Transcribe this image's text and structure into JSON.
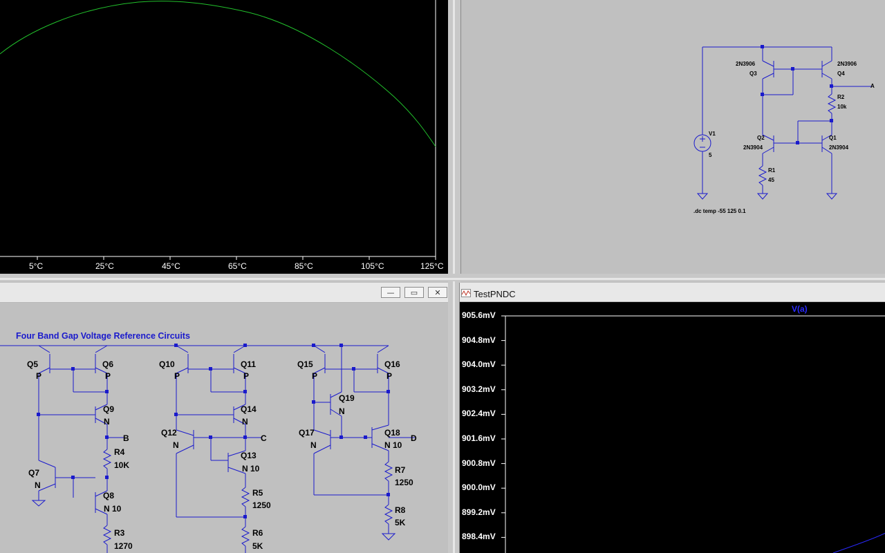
{
  "top_left_plot": {
    "x_ticks": [
      "5°C",
      "25°C",
      "45°C",
      "65°C",
      "85°C",
      "105°C",
      "125°C"
    ],
    "trace_color": "#22c22c"
  },
  "schematic_top": {
    "labels": {
      "q3_model": "2N3906",
      "q3": "Q3",
      "q4_model": "2N3906",
      "q4": "Q4",
      "r2": "R2",
      "r2_val": "10k",
      "node_a": "A",
      "v1": "V1",
      "v1_val": "5",
      "q2": "Q2",
      "q2_model": "2N3904",
      "q1": "Q1",
      "q1_model": "2N3904",
      "r1": "R1",
      "r1_val": "45",
      "directive": ".dc temp -55 125 0.1"
    }
  },
  "schematic_window": {
    "buttons": {
      "minimize": "—",
      "restore": "▭",
      "close": "✕"
    },
    "heading": "Four Band Gap Voltage Reference Circuits",
    "labels": {
      "q5": "Q5",
      "q5_type": "P",
      "q6": "Q6",
      "q6_type": "P",
      "q9": "Q9",
      "q9_type": "N",
      "r4": "R4",
      "r4_val": "10K",
      "node_b": "B",
      "q7": "Q7",
      "q7_type": "N",
      "q8": "Q8",
      "q8_type": "N  10",
      "r3": "R3",
      "r3_val": "1270",
      "q10": "Q10",
      "q10_type": "P",
      "q11": "Q11",
      "q11_type": "P",
      "q14": "Q14",
      "q14_type": "N",
      "q12": "Q12",
      "q12_type": "N",
      "node_c": "C",
      "q13": "Q13",
      "q13_type": "N  10",
      "r5": "R5",
      "r5_val": "1250",
      "r6": "R6",
      "r6_val": "5K",
      "q15": "Q15",
      "q15_type": "P",
      "q16": "Q16",
      "q16_type": "P",
      "q19": "Q19",
      "q19_type": "N",
      "q17": "Q17",
      "q17_type": "N",
      "q18": "Q18",
      "q18_type": "N  10",
      "node_d": "D",
      "r7": "R7",
      "r7_val": "1250",
      "r8": "R8",
      "r8_val": "5K"
    }
  },
  "plot_window": {
    "title": "TestPNDC",
    "buttons": {
      "minimize": "—",
      "restore": "▭",
      "close": "✕"
    },
    "trace_label": "V(a)",
    "y_ticks": [
      "905.6mV",
      "904.8mV",
      "904.0mV",
      "903.2mV",
      "902.4mV",
      "901.6mV",
      "900.8mV",
      "900.0mV",
      "899.2mV",
      "898.4mV"
    ]
  },
  "colors": {
    "wire": "#1a1acc",
    "trace_blue": "#2a2aff",
    "plot_bg": "#000000"
  }
}
